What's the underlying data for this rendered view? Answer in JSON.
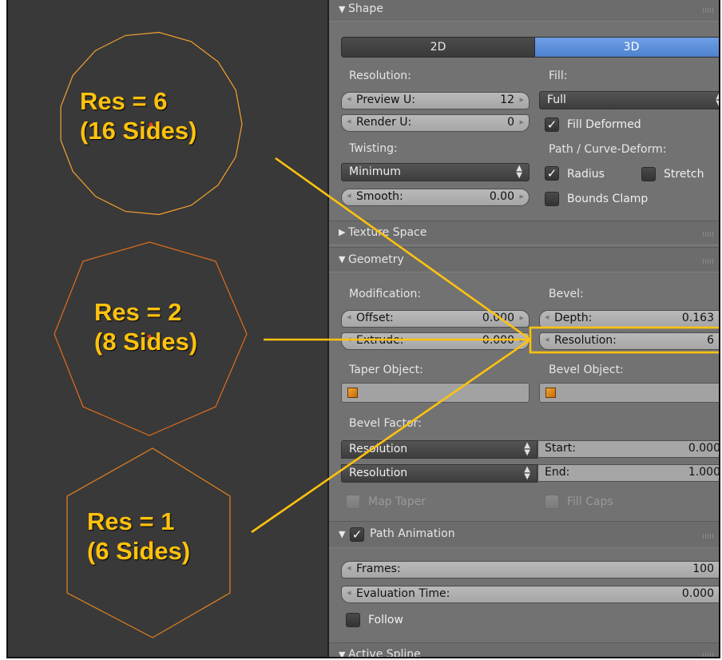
{
  "annotations": {
    "res6": "Res = 6\n(16 Sides)",
    "res2": "Res = 2\n(8 Sides)",
    "res1": "Res = 1\n(6 Sides)"
  },
  "colors": {
    "accent": "#ffc20e",
    "toggle_active": "#5d8fd8",
    "outline": "#e8891a"
  },
  "shape": {
    "header": "Shape",
    "toggle_2d": "2D",
    "toggle_3d": "3D",
    "toggle_selected": "3D",
    "resolution_label": "Resolution:",
    "preview_u": {
      "label": "Preview U:",
      "value": "12"
    },
    "render_u": {
      "label": "Render U:",
      "value": "0"
    },
    "twisting_label": "Twisting:",
    "twisting_value": "Minimum",
    "smooth": {
      "label": "Smooth:",
      "value": "0.00"
    },
    "fill_label": "Fill:",
    "fill_value": "Full",
    "fill_deformed": "Fill Deformed",
    "path_deform_label": "Path / Curve-Deform:",
    "radius": "Radius",
    "stretch": "Stretch",
    "bounds_clamp": "Bounds Clamp"
  },
  "texture_space": {
    "header": "Texture Space"
  },
  "geometry": {
    "header": "Geometry",
    "modification_label": "Modification:",
    "offset": {
      "label": "Offset:",
      "value": "0.000"
    },
    "extrude": {
      "label": "Extrude:",
      "value": "0.000"
    },
    "bevel_label": "Bevel:",
    "depth": {
      "label": "Depth:",
      "value": "0.163"
    },
    "resolution": {
      "label": "Resolution:",
      "value": "6"
    },
    "taper_object_label": "Taper Object:",
    "bevel_object_label": "Bevel Object:",
    "bevel_factor_label": "Bevel Factor:",
    "bevel_factor_mode_1": "Resolution",
    "bevel_factor_mode_2": "Resolution",
    "start": {
      "label": "Start:",
      "value": "0.000"
    },
    "end": {
      "label": "End:",
      "value": "1.000"
    },
    "map_taper": "Map Taper",
    "fill_caps": "Fill Caps"
  },
  "path_animation": {
    "header": "Path Animation",
    "frames": {
      "label": "Frames:",
      "value": "100"
    },
    "evaluation_time": {
      "label": "Evaluation Time:",
      "value": "0.000"
    },
    "follow": "Follow"
  },
  "active_spline": {
    "header": "Active Spline"
  }
}
